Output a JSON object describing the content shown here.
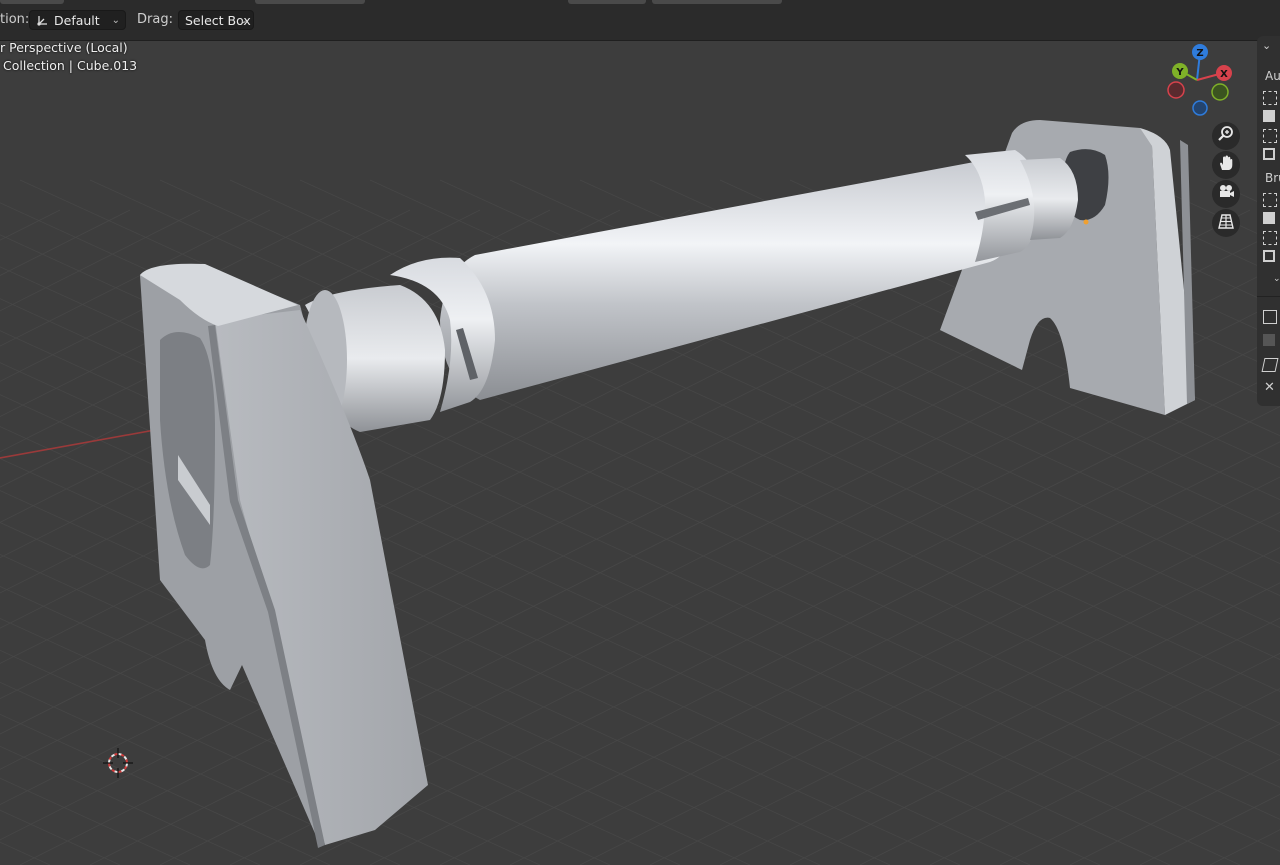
{
  "header": {
    "orientation_label": "tion:",
    "orientation_value": "Default",
    "drag_label": "Drag:",
    "drag_value": "Select Box"
  },
  "viewport": {
    "view_name": "r Perspective (Local)",
    "object_path": "Collection | Cube.013"
  },
  "gizmo": {
    "axes": [
      {
        "label": "Z",
        "color": "#2f7cdc"
      },
      {
        "label": "Y",
        "color": "#7fb128"
      },
      {
        "label": "X",
        "color": "#d7424c"
      }
    ]
  },
  "nav_tools": [
    "zoom-icon",
    "hand-pan-icon",
    "camera-icon",
    "grid-ortho-icon"
  ],
  "side_panel": {
    "section1": "Au",
    "section2": "Bru"
  },
  "colors": {
    "header_bg": "#2b2b2b",
    "viewport_bg": "#3d3d3d",
    "grid_line": "#474747",
    "model_light": "#e3e5e9",
    "model_mid": "#aeb1b6",
    "model_dark": "#7a7d82"
  }
}
